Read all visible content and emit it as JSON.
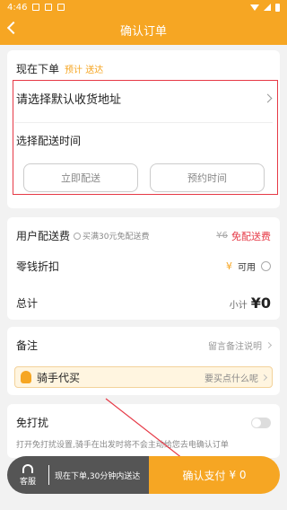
{
  "status_bar": {
    "time": "4:46"
  },
  "header": {
    "title": "确认订单"
  },
  "order_now": {
    "title": "现在下单",
    "eta": "预计 送达"
  },
  "address": {
    "label": "请选择默认收货地址"
  },
  "delivery_time": {
    "label": "选择配送时间",
    "now_button": "立即配送",
    "reserve_button": "预约时间"
  },
  "fees": {
    "delivery_label": "用户配送费",
    "free_hint": "买满30元免配送费",
    "original_fee": "¥6",
    "free_label": "免配送费",
    "coin_label": "零钱折扣",
    "coin_symbol": "¥",
    "coin_available": "可用",
    "total_label": "总计",
    "subtotal_label": "小计",
    "subtotal_value": "¥0"
  },
  "remark": {
    "label": "备注",
    "placeholder": "留言备注说明",
    "rider_buy_label": "骑手代买",
    "rider_buy_hint": "要买点什么呢"
  },
  "dnd": {
    "label": "免打扰",
    "description": "打开免打扰设置,骑手在出发时将不会主动给您去电确认订单"
  },
  "bottom_bar": {
    "service_label": "客服",
    "tip": "现在下单,30分钟内送达",
    "pay_label": "确认支付",
    "pay_amount": "¥ 0"
  },
  "colors": {
    "accent": "#f6a623",
    "highlight_box": "#e63946",
    "free_text": "#e63946"
  },
  "icons": [
    "back-icon",
    "chevron-right-icon",
    "info-icon",
    "headset-icon",
    "rider-icon"
  ]
}
